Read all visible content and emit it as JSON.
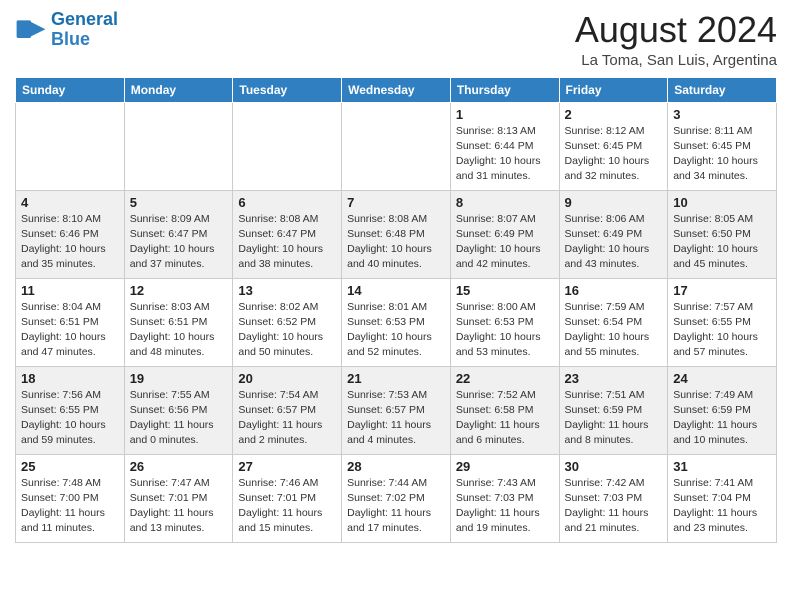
{
  "header": {
    "logo_line1": "General",
    "logo_line2": "Blue",
    "month_year": "August 2024",
    "location": "La Toma, San Luis, Argentina"
  },
  "weekdays": [
    "Sunday",
    "Monday",
    "Tuesday",
    "Wednesday",
    "Thursday",
    "Friday",
    "Saturday"
  ],
  "weeks": [
    [
      {
        "day": "",
        "info": ""
      },
      {
        "day": "",
        "info": ""
      },
      {
        "day": "",
        "info": ""
      },
      {
        "day": "",
        "info": ""
      },
      {
        "day": "1",
        "info": "Sunrise: 8:13 AM\nSunset: 6:44 PM\nDaylight: 10 hours\nand 31 minutes."
      },
      {
        "day": "2",
        "info": "Sunrise: 8:12 AM\nSunset: 6:45 PM\nDaylight: 10 hours\nand 32 minutes."
      },
      {
        "day": "3",
        "info": "Sunrise: 8:11 AM\nSunset: 6:45 PM\nDaylight: 10 hours\nand 34 minutes."
      }
    ],
    [
      {
        "day": "4",
        "info": "Sunrise: 8:10 AM\nSunset: 6:46 PM\nDaylight: 10 hours\nand 35 minutes."
      },
      {
        "day": "5",
        "info": "Sunrise: 8:09 AM\nSunset: 6:47 PM\nDaylight: 10 hours\nand 37 minutes."
      },
      {
        "day": "6",
        "info": "Sunrise: 8:08 AM\nSunset: 6:47 PM\nDaylight: 10 hours\nand 38 minutes."
      },
      {
        "day": "7",
        "info": "Sunrise: 8:08 AM\nSunset: 6:48 PM\nDaylight: 10 hours\nand 40 minutes."
      },
      {
        "day": "8",
        "info": "Sunrise: 8:07 AM\nSunset: 6:49 PM\nDaylight: 10 hours\nand 42 minutes."
      },
      {
        "day": "9",
        "info": "Sunrise: 8:06 AM\nSunset: 6:49 PM\nDaylight: 10 hours\nand 43 minutes."
      },
      {
        "day": "10",
        "info": "Sunrise: 8:05 AM\nSunset: 6:50 PM\nDaylight: 10 hours\nand 45 minutes."
      }
    ],
    [
      {
        "day": "11",
        "info": "Sunrise: 8:04 AM\nSunset: 6:51 PM\nDaylight: 10 hours\nand 47 minutes."
      },
      {
        "day": "12",
        "info": "Sunrise: 8:03 AM\nSunset: 6:51 PM\nDaylight: 10 hours\nand 48 minutes."
      },
      {
        "day": "13",
        "info": "Sunrise: 8:02 AM\nSunset: 6:52 PM\nDaylight: 10 hours\nand 50 minutes."
      },
      {
        "day": "14",
        "info": "Sunrise: 8:01 AM\nSunset: 6:53 PM\nDaylight: 10 hours\nand 52 minutes."
      },
      {
        "day": "15",
        "info": "Sunrise: 8:00 AM\nSunset: 6:53 PM\nDaylight: 10 hours\nand 53 minutes."
      },
      {
        "day": "16",
        "info": "Sunrise: 7:59 AM\nSunset: 6:54 PM\nDaylight: 10 hours\nand 55 minutes."
      },
      {
        "day": "17",
        "info": "Sunrise: 7:57 AM\nSunset: 6:55 PM\nDaylight: 10 hours\nand 57 minutes."
      }
    ],
    [
      {
        "day": "18",
        "info": "Sunrise: 7:56 AM\nSunset: 6:55 PM\nDaylight: 10 hours\nand 59 minutes."
      },
      {
        "day": "19",
        "info": "Sunrise: 7:55 AM\nSunset: 6:56 PM\nDaylight: 11 hours\nand 0 minutes."
      },
      {
        "day": "20",
        "info": "Sunrise: 7:54 AM\nSunset: 6:57 PM\nDaylight: 11 hours\nand 2 minutes."
      },
      {
        "day": "21",
        "info": "Sunrise: 7:53 AM\nSunset: 6:57 PM\nDaylight: 11 hours\nand 4 minutes."
      },
      {
        "day": "22",
        "info": "Sunrise: 7:52 AM\nSunset: 6:58 PM\nDaylight: 11 hours\nand 6 minutes."
      },
      {
        "day": "23",
        "info": "Sunrise: 7:51 AM\nSunset: 6:59 PM\nDaylight: 11 hours\nand 8 minutes."
      },
      {
        "day": "24",
        "info": "Sunrise: 7:49 AM\nSunset: 6:59 PM\nDaylight: 11 hours\nand 10 minutes."
      }
    ],
    [
      {
        "day": "25",
        "info": "Sunrise: 7:48 AM\nSunset: 7:00 PM\nDaylight: 11 hours\nand 11 minutes."
      },
      {
        "day": "26",
        "info": "Sunrise: 7:47 AM\nSunset: 7:01 PM\nDaylight: 11 hours\nand 13 minutes."
      },
      {
        "day": "27",
        "info": "Sunrise: 7:46 AM\nSunset: 7:01 PM\nDaylight: 11 hours\nand 15 minutes."
      },
      {
        "day": "28",
        "info": "Sunrise: 7:44 AM\nSunset: 7:02 PM\nDaylight: 11 hours\nand 17 minutes."
      },
      {
        "day": "29",
        "info": "Sunrise: 7:43 AM\nSunset: 7:03 PM\nDaylight: 11 hours\nand 19 minutes."
      },
      {
        "day": "30",
        "info": "Sunrise: 7:42 AM\nSunset: 7:03 PM\nDaylight: 11 hours\nand 21 minutes."
      },
      {
        "day": "31",
        "info": "Sunrise: 7:41 AM\nSunset: 7:04 PM\nDaylight: 11 hours\nand 23 minutes."
      }
    ]
  ]
}
